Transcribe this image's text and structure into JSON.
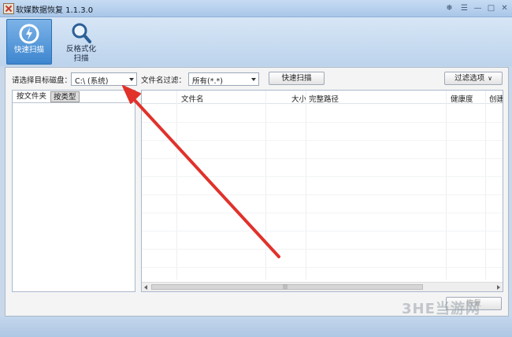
{
  "window": {
    "title": "软媒数据恢复 1.1.3.0"
  },
  "title_controls": {
    "skin_icon": "shirt-icon",
    "menu_icon": "menu-icon",
    "min_icon": "minimize-icon",
    "max_icon": "maximize-icon",
    "close_icon": "close-icon"
  },
  "toolbar": {
    "quick_scan_label": "快速扫描",
    "format_scan_label_line1": "反格式化",
    "format_scan_label_line2": "扫描"
  },
  "disk_select": {
    "label": "请选择目标磁盘：",
    "value": "C:\\  (系统)"
  },
  "filter": {
    "label": "文件名过滤：",
    "value": "所有(*.*)"
  },
  "buttons": {
    "quick_scan": "快速扫描",
    "filter_options": "过滤选项",
    "recover": "恢复"
  },
  "tabs": {
    "by_folder": "按文件夹",
    "by_type": "按类型"
  },
  "file_list": {
    "columns": [
      "文件名",
      "大小",
      "完整路径",
      "健康度",
      "创建"
    ]
  },
  "watermark": "3HE当游网",
  "colors": {
    "accent": "#3d86cf",
    "annotation_arrow": "#e0322b"
  }
}
